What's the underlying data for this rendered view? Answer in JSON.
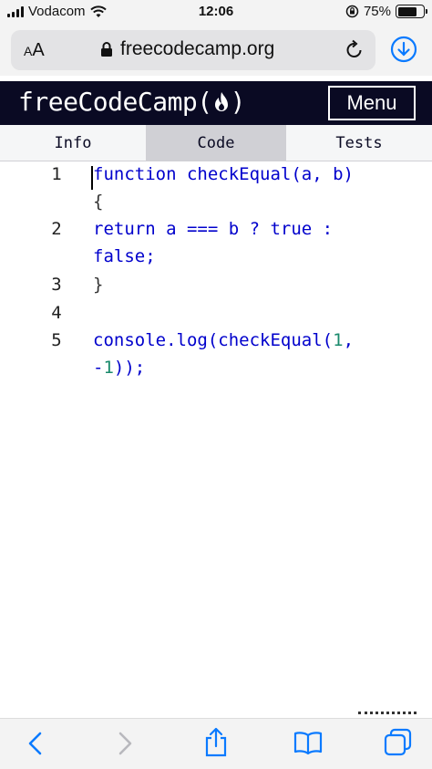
{
  "status_bar": {
    "carrier": "Vodacom",
    "time": "12:06",
    "battery_percent": "75%",
    "battery_level": 0.75
  },
  "browser": {
    "text_size_label_small": "A",
    "text_size_label_large": "A",
    "url": "freecodecamp.org"
  },
  "site": {
    "logo_text": "freeCodeCamp(",
    "logo_close": ")",
    "menu_label": "Menu"
  },
  "tabs": [
    {
      "label": "Info",
      "active": false
    },
    {
      "label": "Code",
      "active": true
    },
    {
      "label": "Tests",
      "active": false
    }
  ],
  "code": {
    "line_numbers": [
      "1",
      "2",
      "3",
      "4",
      "5"
    ],
    "line1a_kw": "function",
    "line1a_rest": " checkEqual(a, b)",
    "line1b": "{",
    "line2a": "return a === b ? true :",
    "line2b": "false;",
    "line3": "}",
    "line5a_fn": "console.log(checkEqual(",
    "line5a_num": "1",
    "line5a_sep": ",",
    "line5b_minus": "-",
    "line5b_num": "1",
    "line5b_end": "));"
  },
  "icons": {
    "lock": "lock-icon",
    "reload": "reload-icon",
    "download": "download-icon",
    "back": "chevron-left-icon",
    "forward": "chevron-right-icon",
    "share": "share-icon",
    "bookmarks": "book-icon",
    "tabs": "tabs-icon"
  },
  "colors": {
    "nav_bg": "#0a0a23",
    "keyword": "#0000cc",
    "number": "#1a8a6c",
    "ios_blue": "#0a7aff"
  }
}
